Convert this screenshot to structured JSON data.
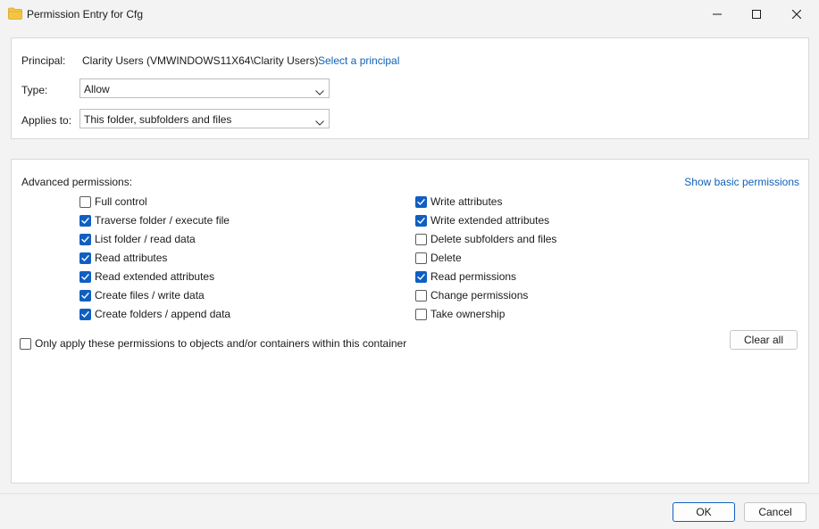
{
  "window": {
    "title": "Permission Entry for Cfg"
  },
  "principal": {
    "label": "Principal:",
    "value": "Clarity Users (VMWINDOWS11X64\\Clarity Users)",
    "select_link": "Select a principal"
  },
  "type": {
    "label": "Type:",
    "selected": "Allow"
  },
  "applies_to": {
    "label": "Applies to:",
    "selected": "This folder, subfolders and files"
  },
  "advanced": {
    "heading": "Advanced permissions:",
    "show_basic_link": "Show basic permissions",
    "left": [
      {
        "label": "Full control",
        "checked": false
      },
      {
        "label": "Traverse folder / execute file",
        "checked": true
      },
      {
        "label": "List folder / read data",
        "checked": true
      },
      {
        "label": "Read attributes",
        "checked": true
      },
      {
        "label": "Read extended attributes",
        "checked": true
      },
      {
        "label": "Create files / write data",
        "checked": true
      },
      {
        "label": "Create folders / append data",
        "checked": true
      }
    ],
    "right": [
      {
        "label": "Write attributes",
        "checked": true
      },
      {
        "label": "Write extended attributes",
        "checked": true
      },
      {
        "label": "Delete subfolders and files",
        "checked": false
      },
      {
        "label": "Delete",
        "checked": false
      },
      {
        "label": "Read permissions",
        "checked": true
      },
      {
        "label": "Change permissions",
        "checked": false
      },
      {
        "label": "Take ownership",
        "checked": false
      }
    ],
    "only_apply": {
      "label": "Only apply these permissions to objects and/or containers within this container",
      "checked": false
    },
    "clear_all": "Clear all"
  },
  "footer": {
    "ok": "OK",
    "cancel": "Cancel"
  },
  "colors": {
    "accent": "#0f5fc2",
    "link": "#0f62b8"
  }
}
